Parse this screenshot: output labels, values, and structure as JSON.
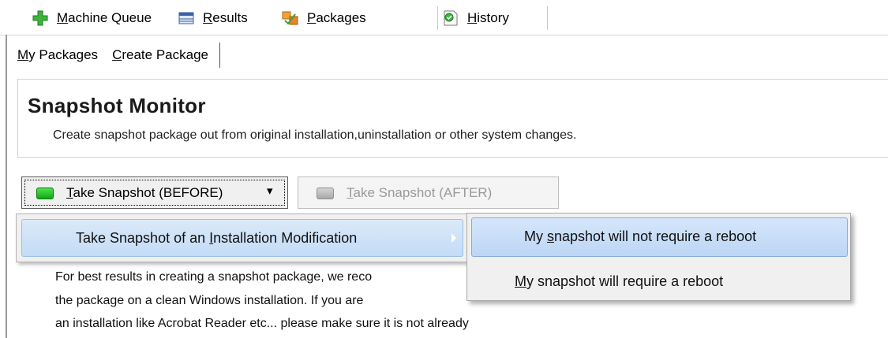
{
  "toolbar": {
    "items": [
      {
        "label": "Machine Queue",
        "accel": "M",
        "rest": "achine Queue",
        "icon": "green-plus-icon"
      },
      {
        "label": "Results",
        "accel": "R",
        "rest": "esults",
        "icon": "results-grid-icon"
      },
      {
        "label": "Packages",
        "accel": "P",
        "rest": "ackages",
        "icon": "packages-icon"
      },
      {
        "label": "History",
        "accel": "H",
        "rest": "istory",
        "icon": "history-icon"
      }
    ]
  },
  "subtabs": [
    {
      "label": "My Packages",
      "accel": "M",
      "pre": "",
      "rest": "y Packages"
    },
    {
      "label": "Create Package",
      "accel": "C",
      "pre": "",
      "rest": "reate Package"
    }
  ],
  "header": {
    "title": "Snapshot Monitor",
    "subtitle": "Create snapshot package out from original installation,uninstallation or other system changes."
  },
  "buttons": {
    "before": {
      "accel": "T",
      "rest": "ake Snapshot (BEFORE)",
      "label": "Take Snapshot (BEFORE)",
      "arrow": "▾"
    },
    "after": {
      "accel": "T",
      "rest": "ake Snapshot (AFTER)",
      "label": "Take Snapshot (AFTER)",
      "enabled": false
    }
  },
  "body": {
    "lines": [
      "For best results in creating a snapshot package, we reco",
      "the package on a clean Windows installation. If you are",
      "an installation like Acrobat Reader etc... please make sure it is not already"
    ]
  },
  "menu": {
    "item": {
      "pre": "Take Snapshot of an ",
      "accel": "I",
      "rest": "nstallation Modification",
      "label": "Take Snapshot of an Installation Modification"
    },
    "submenu": [
      {
        "pre": "My ",
        "accel": "s",
        "rest": "napshot will not require a reboot",
        "label": "My snapshot will not require a reboot",
        "highlighted": true
      },
      {
        "pre": "",
        "accel": "M",
        "rest": "y snapshot will require a reboot",
        "label": "My snapshot will require a reboot",
        "highlighted": false
      }
    ]
  }
}
